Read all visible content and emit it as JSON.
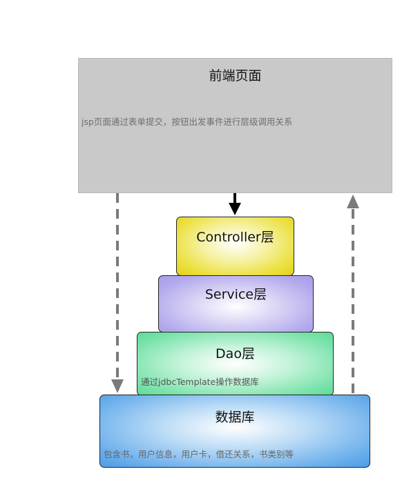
{
  "frontend": {
    "title": "前端页面",
    "description": "jsp页面通过表单提交，按钮出发事件进行层级调用关系",
    "color": "#c9c9c9"
  },
  "layers": {
    "controller": {
      "title": "Controller层",
      "color": "#ebdf3a"
    },
    "service": {
      "title": "Service层",
      "color": "#b1a8ec"
    },
    "dao": {
      "title": "Dao层",
      "description": "通过jdbcTemplate操作数据库",
      "color": "#77e2a9"
    },
    "database": {
      "title": "数据库",
      "description": "包含书，用户信息，用户卡，借还关系，书类别等",
      "color": "#6fb1ec"
    }
  },
  "arrows": {
    "frontend_to_controller": "solid-arrow-down",
    "frontend_to_database": "dashed-arrow-down",
    "database_to_frontend": "dashed-arrow-up",
    "arrow_color_solid": "#000000",
    "arrow_color_dashed": "#7a7a7a"
  }
}
